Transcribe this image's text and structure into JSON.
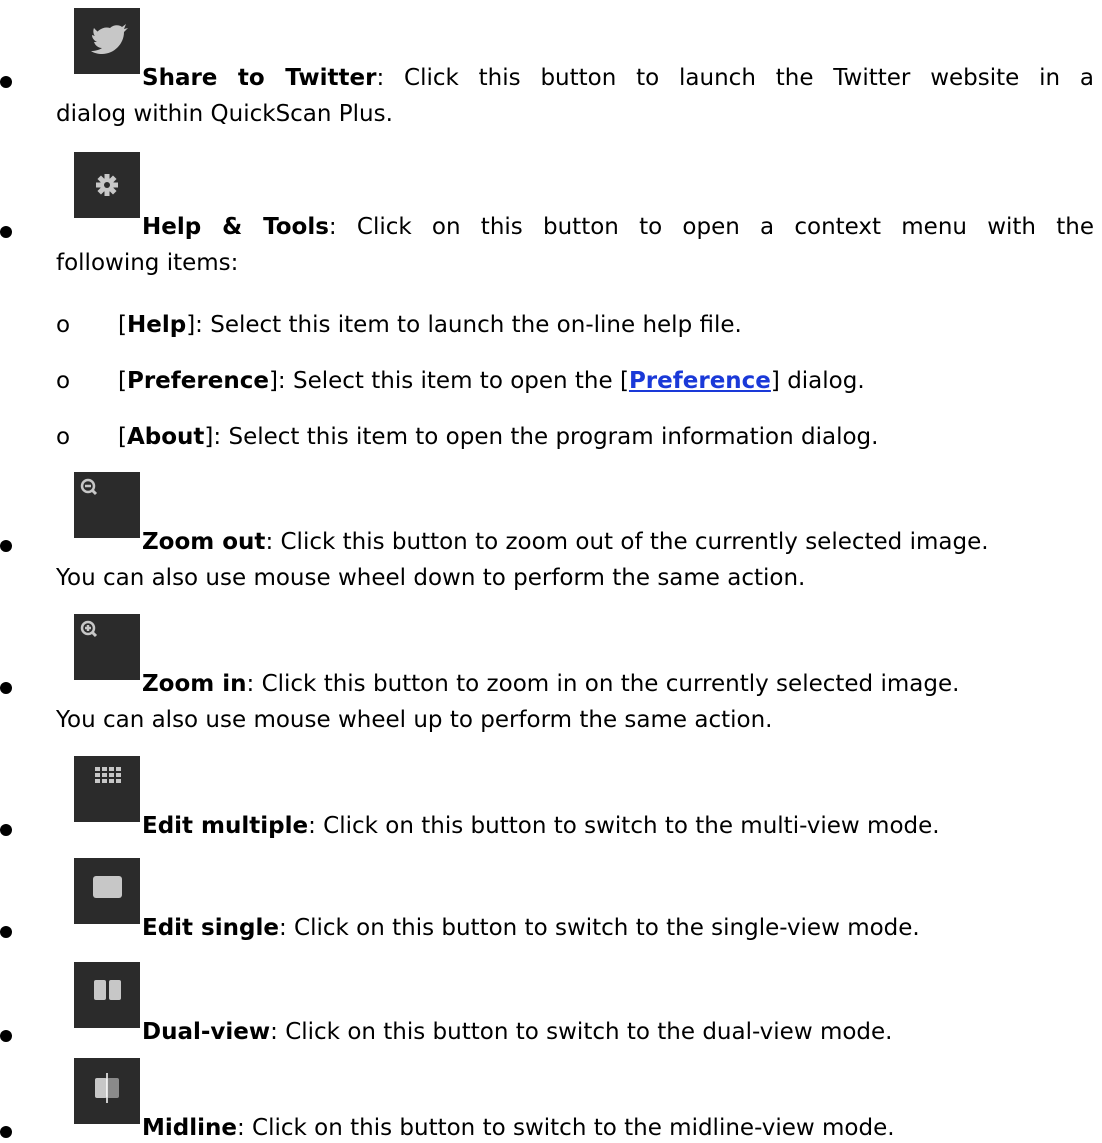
{
  "items": [
    {
      "icon": "twitter-bird-icon",
      "name": "Share to Twitter",
      "line1": ": Click this button to launch the Twitter website in a",
      "line2": "dialog within QuickScan Plus."
    },
    {
      "icon": "gear-icon",
      "name": "Help & Tools",
      "line1": ": Click on this button to open a context menu with the",
      "line2": "following items:",
      "subitems": [
        {
          "bullet": "o",
          "open": "[",
          "name": "Help",
          "close": "]",
          "text": ": Select this item to launch the on-line help file."
        },
        {
          "bullet": "o",
          "open": "[",
          "name": "Preference",
          "close": "]",
          "text_before_link": ": Select this item to open the [",
          "link": "Preference",
          "text_after_link": "] dialog."
        },
        {
          "bullet": "o",
          "open": "[",
          "name": "About",
          "close": "]",
          "text": ": Select this item to open the program information dialog."
        }
      ]
    },
    {
      "icon": "zoom-out-icon",
      "name": "Zoom out",
      "line1": ": Click this button to zoom out of the currently selected image.",
      "line2": "You can also use mouse wheel down to perform the same action."
    },
    {
      "icon": "zoom-in-icon",
      "name": "Zoom in",
      "line1": ": Click this button to zoom in on the currently selected image.",
      "line2": "You can also use mouse wheel up to perform the same action."
    },
    {
      "icon": "multi-view-grid-icon",
      "name": "Edit multiple",
      "line1": ": Click on this button to switch to the multi-view mode."
    },
    {
      "icon": "single-view-icon",
      "name": "Edit single",
      "line1": ": Click on this button to switch to the single-view mode."
    },
    {
      "icon": "dual-view-icon",
      "name": "Dual-view",
      "line1": ": Click on this button to switch to the dual-view mode."
    },
    {
      "icon": "midline-view-icon",
      "name": "Midline",
      "line1": ": Click on this button to switch to the midline-view mode."
    }
  ]
}
